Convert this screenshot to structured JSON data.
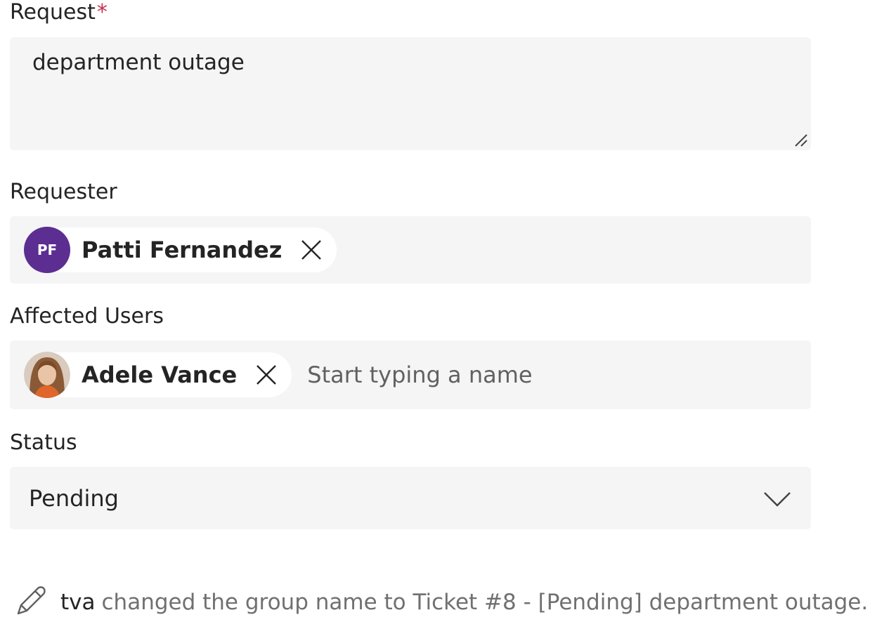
{
  "form": {
    "request": {
      "label": "Request",
      "required_marker": "*",
      "value": "department outage"
    },
    "requester": {
      "label": "Requester",
      "chips": [
        {
          "name": "Patti Fernandez",
          "initials": "PF",
          "avatar_color": "#5c2e91"
        }
      ]
    },
    "affected_users": {
      "label": "Affected Users",
      "chips": [
        {
          "name": "Adele Vance",
          "avatar": "photo"
        }
      ],
      "placeholder": "Start typing a name"
    },
    "status": {
      "label": "Status",
      "value": "Pending"
    }
  },
  "activity": {
    "icon": "pencil-icon",
    "user": "tva",
    "text": "changed the group name to Ticket #8 - [Pending] department outage."
  },
  "colors": {
    "field_background": "#f5f5f5",
    "required": "#c4314b",
    "muted_text": "#707070"
  }
}
